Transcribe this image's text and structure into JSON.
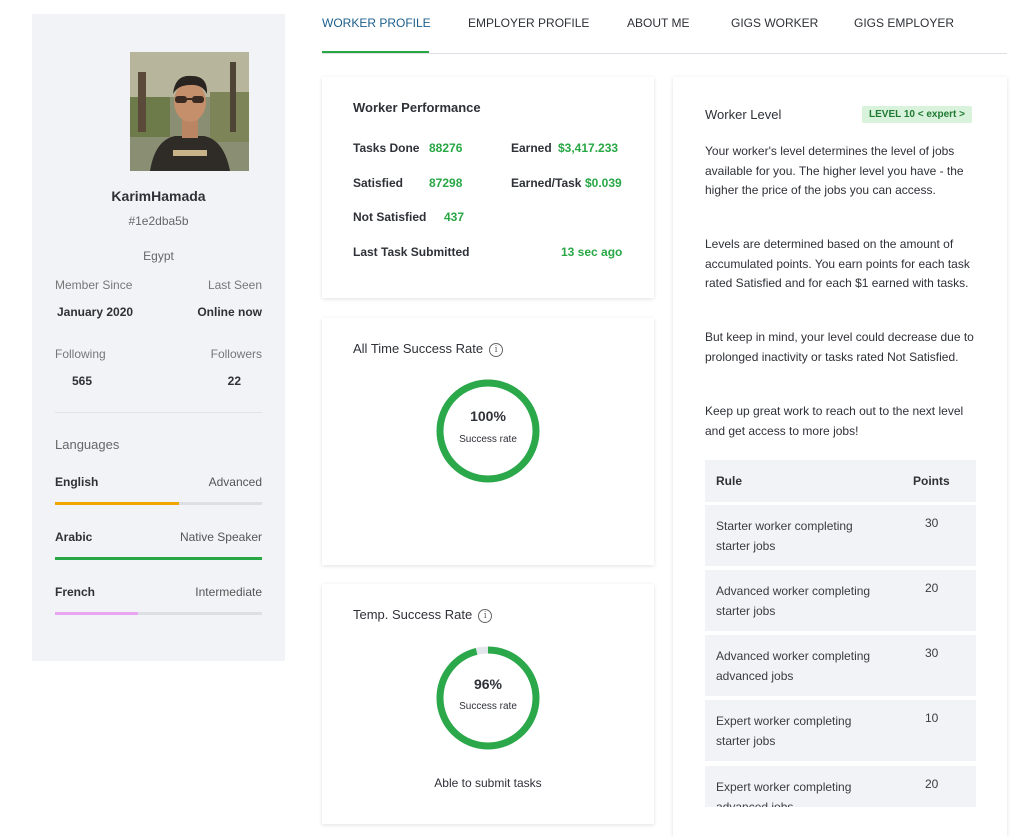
{
  "profile": {
    "name": "KarimHamada",
    "id": "#1e2dba5b",
    "country": "Egypt",
    "member_since_label": "Member Since",
    "member_since": "January 2020",
    "last_seen_label": "Last Seen",
    "last_seen": "Online now",
    "following_label": "Following",
    "following": "565",
    "followers_label": "Followers",
    "followers": "22"
  },
  "languages": {
    "title": "Languages",
    "items": [
      {
        "name": "English",
        "level": "Advanced",
        "progress": 0.6,
        "color": "#f0a500"
      },
      {
        "name": "Arabic",
        "level": "Native Speaker",
        "progress": 1.0,
        "color": "#28a745"
      },
      {
        "name": "French",
        "level": "Intermediate",
        "progress": 0.4,
        "color": "#e9a6f0"
      }
    ]
  },
  "tabs": [
    {
      "label": "WORKER PROFILE",
      "active": true
    },
    {
      "label": "EMPLOYER PROFILE",
      "active": false
    },
    {
      "label": "ABOUT ME",
      "active": false
    },
    {
      "label": "GIGS WORKER",
      "active": false
    },
    {
      "label": "GIGS EMPLOYER",
      "active": false
    }
  ],
  "performance": {
    "title": "Worker Performance",
    "tasks_done_label": "Tasks Done",
    "tasks_done": "88276",
    "earned_label": "Earned",
    "earned": "$3,417.233",
    "satisfied_label": "Satisfied",
    "satisfied": "87298",
    "earned_per_task_label": "Earned/Task",
    "earned_per_task": "$0.039",
    "not_satisfied_label": "Not Satisfied",
    "not_satisfied": "437",
    "last_task_label": "Last Task Submitted",
    "last_task": "13 sec ago"
  },
  "all_time": {
    "title": "All Time Success Rate",
    "info": "i",
    "percent_text": "100%",
    "percent": 100,
    "sublabel": "Success rate"
  },
  "temp": {
    "title": "Temp. Success Rate",
    "info": "i",
    "percent_text": "96%",
    "percent": 96,
    "sublabel": "Success rate",
    "status": "Able to submit tasks"
  },
  "level": {
    "title": "Worker Level",
    "badge": "LEVEL 10 < expert >",
    "paragraphs": [
      "Your worker's level determines the level of jobs available for you. The higher level you have - the higher the price of the jobs you can access.",
      "Levels are determined based on the amount of accumulated points. You earn points for each task rated Satisfied and for each $1 earned with tasks.",
      "But keep in mind, your level could decrease due to prolonged inactivity or tasks rated Not Satisfied.",
      "Keep up great work to reach out to the next level and get access to more jobs!"
    ],
    "table": {
      "headers": [
        "Rule",
        "Points"
      ],
      "rows": [
        {
          "rule": "Starter worker completing starter jobs",
          "points": "30"
        },
        {
          "rule": "Advanced worker completing starter jobs",
          "points": "20"
        },
        {
          "rule": "Advanced worker completing advanced jobs",
          "points": "30"
        },
        {
          "rule": "Expert worker completing starter jobs",
          "points": "10"
        },
        {
          "rule": "Expert worker completing advanced jobs",
          "points": "20"
        }
      ]
    }
  },
  "colors": {
    "accent": "#28a745",
    "ring": "#2aa84a",
    "tab_active": "#1b5e8c"
  }
}
